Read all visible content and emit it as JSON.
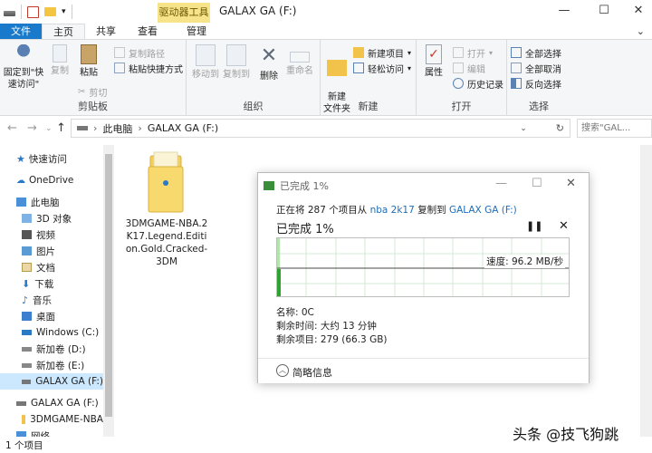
{
  "title": {
    "context_tab": "驱动器工具",
    "window_title": "GALAX GA (F:)"
  },
  "tabs": {
    "file": "文件",
    "home": "主页",
    "share": "共享",
    "view": "查看",
    "manage": "管理"
  },
  "ribbon": {
    "clipboard": {
      "label": "剪贴板",
      "pin": "固定到\"快速访问\"",
      "copy": "复制",
      "paste": "粘贴",
      "copy_path": "复制路径",
      "paste_shortcut": "粘贴快捷方式",
      "cut": "剪切"
    },
    "organize": {
      "label": "组织",
      "move_to": "移动到",
      "copy_to": "复制到",
      "delete": "删除",
      "rename": "重命名"
    },
    "new": {
      "label": "新建",
      "new_folder": "新建\n文件夹",
      "new_item": "新建项目",
      "easy_access": "轻松访问"
    },
    "open": {
      "label": "打开",
      "properties": "属性",
      "open": "打开",
      "edit": "编辑",
      "history": "历史记录"
    },
    "select": {
      "label": "选择",
      "select_all": "全部选择",
      "select_none": "全部取消",
      "invert": "反向选择"
    }
  },
  "address": {
    "path_root": "此电脑",
    "path_leaf": "GALAX GA (F:)",
    "search_placeholder": "搜索\"GAL..."
  },
  "nav_pane": {
    "items": [
      {
        "label": "快速访问"
      },
      {
        "label": "OneDrive"
      },
      {
        "label": "此电脑"
      },
      {
        "label": "3D 对象"
      },
      {
        "label": "视频"
      },
      {
        "label": "图片"
      },
      {
        "label": "文档"
      },
      {
        "label": "下载"
      },
      {
        "label": "音乐"
      },
      {
        "label": "桌面"
      },
      {
        "label": "Windows (C:)"
      },
      {
        "label": "新加卷 (D:)"
      },
      {
        "label": "新加卷 (E:)"
      },
      {
        "label": "GALAX GA (F:)"
      },
      {
        "label": "GALAX GA (F:)"
      },
      {
        "label": "3DMGAME-NBA"
      },
      {
        "label": "网络"
      }
    ]
  },
  "content": {
    "folder_name": "3DMGAME-NBA.2K17.Legend.Edition.Gold.Cracked-3DM"
  },
  "dialog": {
    "title": "已完成 1%",
    "sub_prefix": "正在将 287 个项目从 ",
    "sub_source": "nba 2k17",
    "sub_middle": " 复制到 ",
    "sub_dest": "GALAX GA (F:)",
    "heading": "已完成 1%",
    "progress_percent": 1,
    "speed": "速度: 96.2 MB/秒",
    "name_line": "名称: 0C",
    "time_line": "剩余时间: 大约 13 分钟",
    "items_line": "剩余项目: 279 (66.3 GB)",
    "less_info": "简略信息"
  },
  "status": {
    "count": "1 个项目"
  },
  "watermark": "头条 @技飞狗跳"
}
